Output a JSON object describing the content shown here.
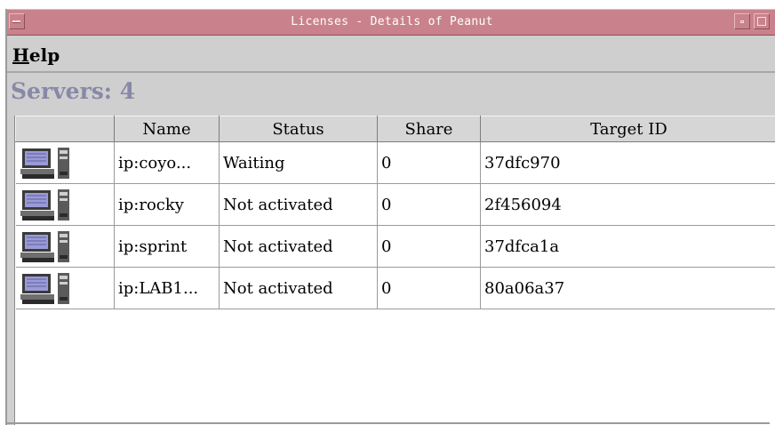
{
  "window": {
    "title": "Licenses - Details of Peanut"
  },
  "menubar": {
    "help_mnemonic": "H",
    "help_rest": "elp"
  },
  "servers_header": "Servers: 4",
  "table": {
    "columns": [
      "",
      "Name",
      "Status",
      "Share",
      "Target ID"
    ],
    "rows": [
      {
        "icon": "server-computer-icon",
        "name": "ip:coyo...",
        "status": "Waiting",
        "share": "0",
        "target_id": "37dfc970"
      },
      {
        "icon": "server-computer-icon",
        "name": "ip:rocky",
        "status": "Not activated",
        "share": "0",
        "target_id": "2f456094"
      },
      {
        "icon": "server-computer-icon",
        "name": "ip:sprint",
        "status": "Not activated",
        "share": "0",
        "target_id": "37dfca1a"
      },
      {
        "icon": "server-computer-icon",
        "name": "ip:LAB1...",
        "status": "Not activated",
        "share": "0",
        "target_id": "80a06a37"
      }
    ]
  },
  "colors": {
    "titlebar": "#c9828b",
    "servers_header": "#8888a8",
    "window_bg": "#cfcfcf"
  }
}
